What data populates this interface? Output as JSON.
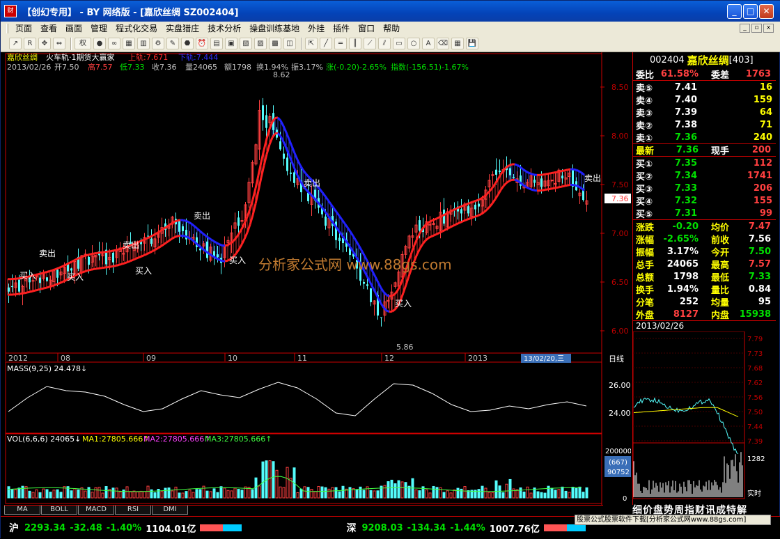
{
  "window": {
    "title": "【创幻专用】 - BY 网络版 - [嘉欣丝绸 SZ002404]",
    "min": "_",
    "max": "□",
    "close": "✕"
  },
  "menu": [
    "页面",
    "查看",
    "画面",
    "管理",
    "程式化交易",
    "实盘猎庄",
    "技术分析",
    "操盘训练基地",
    "外挂",
    "插件",
    "窗口",
    "帮助"
  ],
  "toolbar": {
    "quan_label": "权"
  },
  "chart": {
    "header1": {
      "name": "嘉欣丝绸",
      "indicator": "火车轨·1期货大赢家",
      "upper": "上轨:7.671",
      "lower": "下轨:7.444"
    },
    "header2": {
      "date": "2013/02/26",
      "open": "开7.50",
      "high": "高7.57",
      "low": "低7.33",
      "close": "收7.36",
      "vol": "量24065",
      "amt": "额1798",
      "turn": "换1.94%",
      "amp": "振3.17%",
      "chg": "涨(-0.20)-2.65%",
      "idx": "指数(-156.51)-1.67%"
    },
    "price_ticks": [
      "8.50",
      "8.00",
      "7.50",
      "7.00",
      "6.50",
      "6.00"
    ],
    "current_price": "7.36",
    "high_mark": "8.62",
    "low_mark": "5.86",
    "signals": {
      "buy": "买入",
      "sell": "卖出"
    },
    "watermark": "分析家公式网 www.88gs.com",
    "x_labels": [
      "2012",
      "08",
      "09",
      "10",
      "11",
      "12",
      "2013"
    ],
    "cursor_date": "13/02/20,三",
    "period": "日线",
    "mass_title": "MASS(9,25) 24.478↓",
    "mass_ticks": [
      "26.00",
      "24.00"
    ],
    "vol_title": "VOL(6,6,6) 24065↓",
    "vol_ma1": "MA1:27805.666↑",
    "vol_ma2": "MA2:27805.666↑",
    "vol_ma3": "MA3:27805.666↑",
    "vol_ticks": [
      "200000",
      "0"
    ],
    "vol_box1": "(667)",
    "vol_box2": "90752"
  },
  "tabs": [
    "MA",
    "BOLL",
    "MACD",
    "RSI",
    "DMI"
  ],
  "quote": {
    "code": "002404",
    "name": "嘉欣丝绸",
    "suffix": "[403]",
    "weibi": {
      "l1": "委比",
      "v1": "61.58%",
      "l2": "委差",
      "v2": "1763"
    },
    "sells": [
      {
        "l": "卖⑤",
        "p": "7.41",
        "q": "16"
      },
      {
        "l": "卖④",
        "p": "7.40",
        "q": "159"
      },
      {
        "l": "卖③",
        "p": "7.39",
        "q": "64"
      },
      {
        "l": "卖②",
        "p": "7.38",
        "q": "71"
      },
      {
        "l": "卖①",
        "p": "7.36",
        "q": "240"
      }
    ],
    "latest": {
      "l1": "最新",
      "v1": "7.36",
      "l2": "现手",
      "v2": "200"
    },
    "buys": [
      {
        "l": "买①",
        "p": "7.35",
        "q": "112"
      },
      {
        "l": "买②",
        "p": "7.34",
        "q": "1741"
      },
      {
        "l": "买③",
        "p": "7.33",
        "q": "206"
      },
      {
        "l": "买④",
        "p": "7.32",
        "q": "155"
      },
      {
        "l": "买⑤",
        "p": "7.31",
        "q": "99"
      }
    ],
    "stats": [
      {
        "l1": "涨跌",
        "v1": "-0.20",
        "l2": "均价",
        "v2": "7.47",
        "c1": "#00e000",
        "c2": "#ff4040"
      },
      {
        "l1": "涨幅",
        "v1": "-2.65%",
        "l2": "前收",
        "v2": "7.56",
        "c1": "#00e000",
        "c2": "#fff"
      },
      {
        "l1": "振幅",
        "v1": "3.17%",
        "l2": "今开",
        "v2": "7.50",
        "c1": "#fff",
        "c2": "#00e000"
      },
      {
        "l1": "总手",
        "v1": "24065",
        "l2": "最高",
        "v2": "7.57",
        "c1": "#fff",
        "c2": "#ff4040"
      },
      {
        "l1": "总额",
        "v1": "1798",
        "l2": "最低",
        "v2": "7.33",
        "c1": "#fff",
        "c2": "#00e000"
      },
      {
        "l1": "换手",
        "v1": "1.94%",
        "l2": "量比",
        "v2": "0.84",
        "c1": "#fff",
        "c2": "#fff"
      },
      {
        "l1": "分笔",
        "v1": "252",
        "l2": "均量",
        "v2": "95",
        "c1": "#fff",
        "c2": "#fff"
      },
      {
        "l1": "外盘",
        "v1": "8127",
        "l2": "内盘",
        "v2": "15938",
        "c1": "#ff4040",
        "c2": "#00e000"
      }
    ],
    "mini_date": "2013/02/26",
    "mini_ticks": [
      "7.79",
      "7.73",
      "7.68",
      "7.62",
      "7.56",
      "7.50",
      "7.44",
      "7.39"
    ],
    "mini_vol_max": "1282",
    "mini_rt": "实时",
    "bottom_tabs": "细价盘势周指财讯成特解"
  },
  "status": {
    "sh_label": "沪",
    "sh": "2293.34",
    "sh_chg": "-32.48",
    "sh_pct": "-1.40%",
    "sh_amt": "1104.01亿",
    "sz_label": "深",
    "sz": "9208.03",
    "sz_chg": "-134.34",
    "sz_pct": "-1.44%",
    "sz_amt": "1007.76亿",
    "ad": "股票公式股票软件下载[分析家公式网www.88gs.com]"
  }
}
